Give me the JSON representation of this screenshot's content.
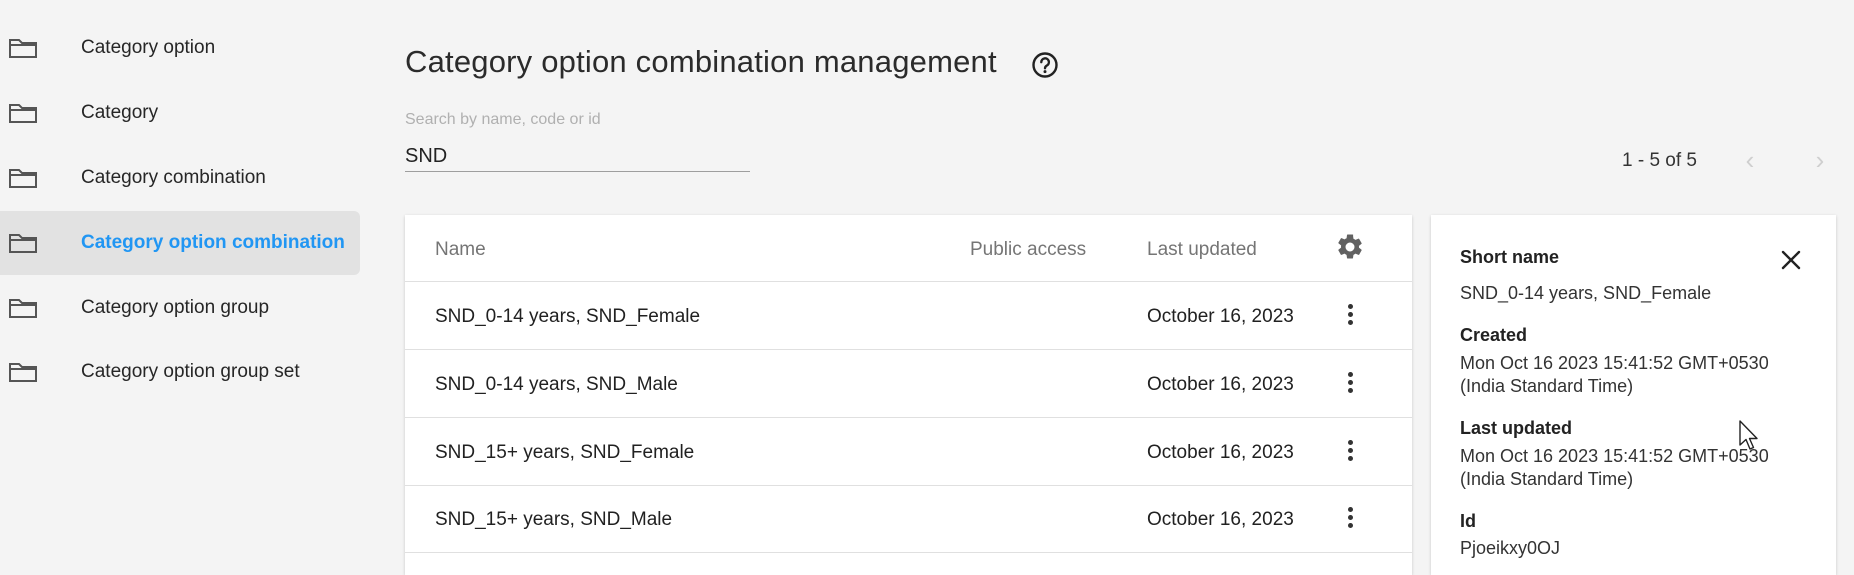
{
  "sidebar": {
    "items": [
      {
        "label": "Category option",
        "active": false
      },
      {
        "label": "Category",
        "active": false
      },
      {
        "label": "Category combination",
        "active": false
      },
      {
        "label": "Category option combination",
        "active": true
      },
      {
        "label": "Category option group",
        "active": false
      },
      {
        "label": "Category option group set",
        "active": false
      }
    ]
  },
  "header": {
    "title": "Category option combination management",
    "help_icon": "help-circle-icon"
  },
  "search": {
    "placeholder": "Search by name, code or id",
    "value": "SND"
  },
  "pager": {
    "text": "1 - 5 of 5",
    "prev_icon": "chevron-left-icon",
    "next_icon": "chevron-right-icon"
  },
  "table": {
    "columns": [
      "Name",
      "Public access",
      "Last updated"
    ],
    "rows": [
      {
        "name": "SND_0-14 years, SND_Female",
        "public_access": "",
        "last_updated": "October 16, 2023"
      },
      {
        "name": "SND_0-14 years, SND_Male",
        "public_access": "",
        "last_updated": "October 16, 2023"
      },
      {
        "name": "SND_15+ years, SND_Female",
        "public_access": "",
        "last_updated": "October 16, 2023"
      },
      {
        "name": "SND_15+ years, SND_Male",
        "public_access": "",
        "last_updated": "October 16, 2023"
      }
    ]
  },
  "details": {
    "short_name_label": "Short name",
    "short_name": "SND_0-14 years, SND_Female",
    "created_label": "Created",
    "created_line1": "Mon Oct 16 2023 15:41:52 GMT+0530",
    "created_line2": "(India Standard Time)",
    "updated_label": "Last updated",
    "updated_line1": "Mon Oct 16 2023 15:41:52 GMT+0530",
    "updated_line2": "(India Standard Time)",
    "id_label": "Id",
    "id": "Pjoeikxy0OJ"
  },
  "colors": {
    "accent": "#2196f3",
    "background": "#f4f4f4",
    "active_item_bg": "#e2e2e2"
  }
}
